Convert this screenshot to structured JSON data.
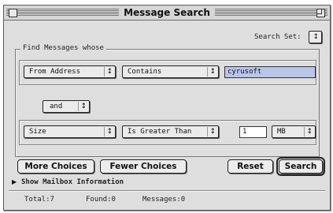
{
  "window": {
    "title": "Message Search"
  },
  "search_set": {
    "label": "Search Set:"
  },
  "criteria": {
    "group_label": "Find Messages whose",
    "row1": {
      "field": "From Address",
      "operator": "Contains",
      "value": "cyrusoft"
    },
    "conjunction": "and",
    "row2": {
      "field": "Size",
      "operator": "Is Greater Than",
      "value": "1",
      "unit": "MB"
    }
  },
  "buttons": {
    "more_choices": "More Choices",
    "fewer_choices": "Fewer Choices",
    "reset": "Reset",
    "search": "Search"
  },
  "disclosure": {
    "label": "Show Mailbox Information"
  },
  "status": {
    "total": "Total:7",
    "found": "Found:0",
    "messages": "Messages:0"
  },
  "icons": {
    "close_box": "close-box-icon",
    "zoom_box": "zoom-box-icon",
    "popup_arrows": "up-down-arrows-icon",
    "disclosure": "disclosure-triangle-icon"
  }
}
